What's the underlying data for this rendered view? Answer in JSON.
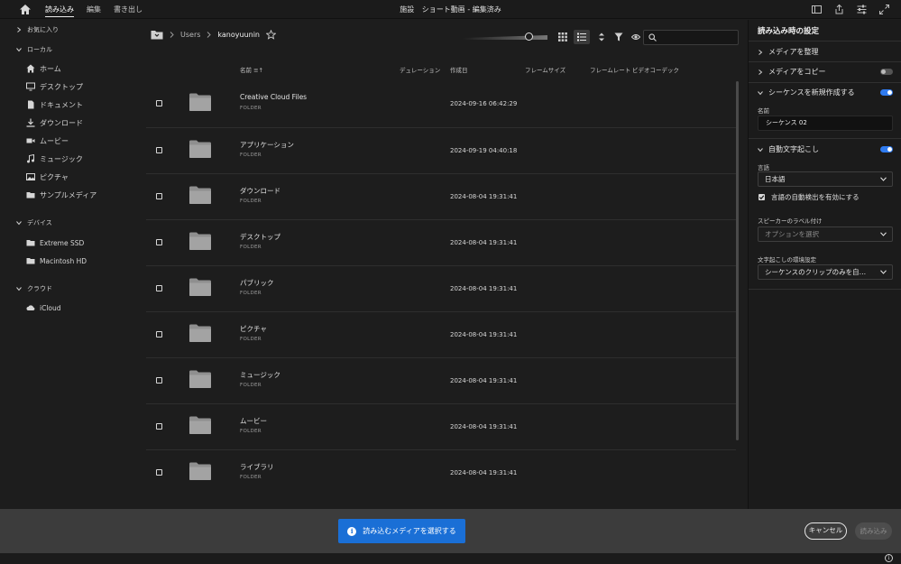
{
  "topbar": {
    "nav": [
      "読み込み",
      "編集",
      "書き出し"
    ],
    "active_nav": "読み込み",
    "title_left": "施設",
    "title_right": "ショート動画 - 編集済み"
  },
  "sidebar": {
    "favorites_label": "お気に入り",
    "local_label": "ローカル",
    "local_items": [
      "ホーム",
      "デスクトップ",
      "ドキュメント",
      "ダウンロード",
      "ムービー",
      "ミュージック",
      "ピクチャ",
      "サンプルメディア"
    ],
    "devices_label": "デバイス",
    "device_items": [
      "Extreme SSD",
      "Macintosh HD"
    ],
    "cloud_label": "クラウド",
    "cloud_items": [
      "iCloud"
    ]
  },
  "browser": {
    "path": [
      "Users",
      "kanoyuunin"
    ],
    "columns": {
      "name": "名前",
      "duration": "デュレーション",
      "created": "作成日",
      "frame_size": "フレームサイズ",
      "frame_rate": "フレームレート",
      "video_codec": "ビデオコーデック"
    },
    "rows": [
      {
        "name": "Creative Cloud Files",
        "type": "FOLDER",
        "date": "2024-09-16 06:42:29"
      },
      {
        "name": "アプリケーション",
        "type": "FOLDER",
        "date": "2024-09-19 04:40:18"
      },
      {
        "name": "ダウンロード",
        "type": "FOLDER",
        "date": "2024-08-04 19:31:41"
      },
      {
        "name": "デスクトップ",
        "type": "FOLDER",
        "date": "2024-08-04 19:31:41"
      },
      {
        "name": "パブリック",
        "type": "FOLDER",
        "date": "2024-08-04 19:31:41"
      },
      {
        "name": "ピクチャ",
        "type": "FOLDER",
        "date": "2024-08-04 19:31:41"
      },
      {
        "name": "ミュージック",
        "type": "FOLDER",
        "date": "2024-08-04 19:31:41"
      },
      {
        "name": "ムービー",
        "type": "FOLDER",
        "date": "2024-08-04 19:31:41"
      },
      {
        "name": "ライブラリ",
        "type": "FOLDER",
        "date": "2024-08-04 19:31:41"
      }
    ]
  },
  "settings": {
    "title": "読み込み時の設定",
    "organize_media": "メディアを整理",
    "copy_media": "メディアをコピー",
    "copy_media_on": false,
    "new_sequence": "シーケンスを新規作成する",
    "new_sequence_on": true,
    "name_label": "名前",
    "sequence_name": "シーケンス 02",
    "auto_transcribe": "自動文字起こし",
    "auto_transcribe_on": true,
    "language_label": "言語",
    "language_value": "日本語",
    "auto_detect_label": "言語の自動検出を有効にする",
    "auto_detect_checked": true,
    "speaker_label": "スピーカーのラベル付け",
    "speaker_placeholder": "オプションを選択",
    "env_label": "文字起こしの環境設定",
    "env_value": "シーケンスのクリップのみを自…"
  },
  "bottom": {
    "select_media": "読み込むメディアを選択する",
    "cancel": "キャンセル",
    "import": "読み込み"
  },
  "colors": {
    "accent": "#1a6fd6",
    "toggle_on": "#2f7bf0",
    "background": "#1d1d1d",
    "bottom_bar": "#3c3c3c"
  }
}
